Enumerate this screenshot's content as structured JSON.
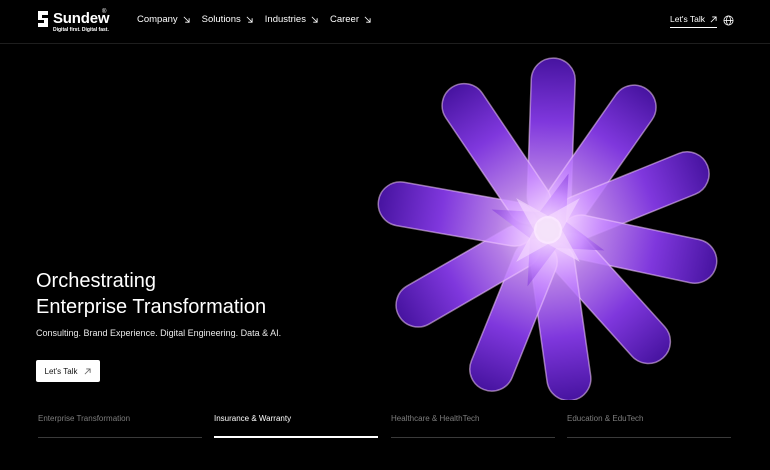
{
  "brand": {
    "name": "Sundew",
    "registered": "®",
    "tagline": "Digital first. Digital fast."
  },
  "nav": {
    "items": [
      {
        "label": "Company",
        "icon": "arrow-down-right-icon"
      },
      {
        "label": "Solutions",
        "icon": "arrow-down-right-icon"
      },
      {
        "label": "Industries",
        "icon": "arrow-down-right-icon"
      },
      {
        "label": "Career",
        "icon": "arrow-down-right-icon"
      }
    ],
    "cta_label": "Let's Talk",
    "cta_icon": "arrow-up-right-icon",
    "language_icon": "globe-icon"
  },
  "hero": {
    "title_line1": "Orchestrating",
    "title_line2": "Enterprise Transformation",
    "subtitle": "Consulting. Brand Experience. Digital Engineering. Data & AI.",
    "button_label": "Let's Talk",
    "button_icon": "arrow-up-right-icon"
  },
  "tabs": [
    {
      "label": "Enterprise Transformation",
      "active": false
    },
    {
      "label": "Insurance & Warranty",
      "active": true
    },
    {
      "label": "Healthcare & HealthTech",
      "active": false
    },
    {
      "label": "Education & EduTech",
      "active": false
    }
  ],
  "colors": {
    "background": "#000000",
    "accent_purple": "#8a3cf0",
    "accent_pink": "#d36bff",
    "tab_inactive": "#7d7d7d"
  }
}
